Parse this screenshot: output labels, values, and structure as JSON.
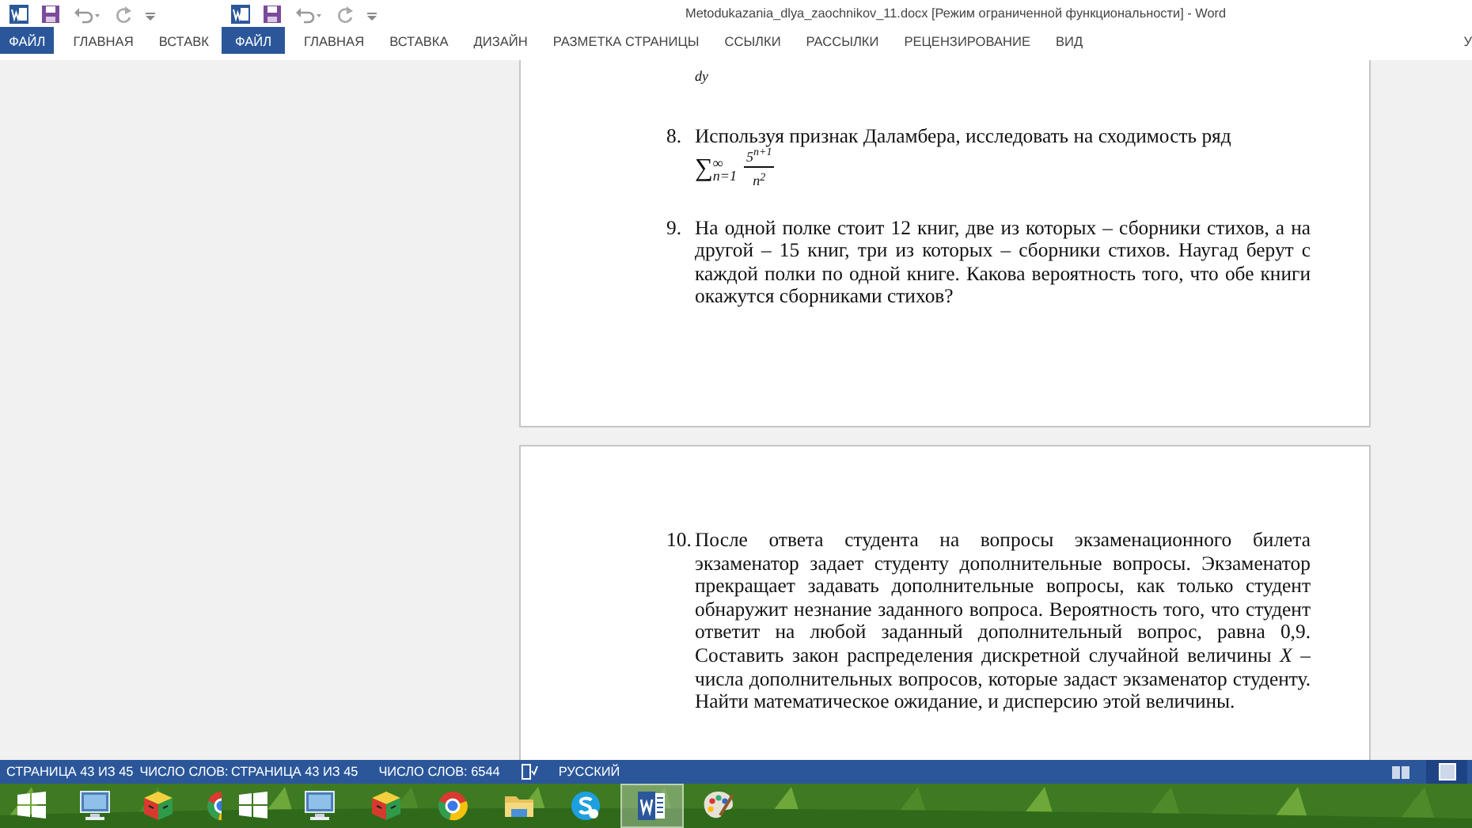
{
  "title_bar": {
    "title": "Metodukazania_dlya_zaochnikov_11.docx [Режим ограниченной функциональности] - Word"
  },
  "ribbon_tabs_back": [
    {
      "label": "ФАЙЛ",
      "kind": "file"
    },
    {
      "label": "ГЛАВНАЯ",
      "kind": "tab"
    },
    {
      "label": "ВСТАВК",
      "kind": "tab"
    }
  ],
  "ribbon_tabs": [
    {
      "label": "ФАЙЛ",
      "kind": "file"
    },
    {
      "label": "ГЛАВНАЯ",
      "kind": "tab"
    },
    {
      "label": "ВСТАВКА",
      "kind": "tab"
    },
    {
      "label": "ДИЗАЙН",
      "kind": "tab"
    },
    {
      "label": "РАЗМЕТКА СТРАНИЦЫ",
      "kind": "tab"
    },
    {
      "label": "ССЫЛКИ",
      "kind": "tab"
    },
    {
      "label": "РАССЫЛКИ",
      "kind": "tab"
    },
    {
      "label": "РЕЦЕНЗИРОВАНИЕ",
      "kind": "tab"
    },
    {
      "label": "ВИД",
      "kind": "tab"
    }
  ],
  "user": "У",
  "pages": [
    {
      "blocks": [
        {
          "kind": "fragment",
          "text": "dy"
        },
        {
          "kind": "item",
          "number": "8.",
          "text": "Используя признак Даламбера, исследовать на сходимость ряд",
          "formula": {
            "sum": "∑",
            "lower": "n=1",
            "upper": "∞",
            "numerator": "5$^{n+1}$",
            "denominator": "n$^{2}$"
          }
        },
        {
          "kind": "item",
          "number": "9.",
          "text": "На одной полке стоит 12 книг, две из которых – сборники стихов, а на другой – 15 книг, три из которых – сборники стихов. Наугад берут с каждой полки по одной книге. Какова вероятность того, что обе книги окажутся сборниками стихов?"
        }
      ]
    },
    {
      "blocks": [
        {
          "kind": "item",
          "number": "10.",
          "text": "После ответа студента на вопросы экзаменационного билета экзаменатор задает студенту дополнительные вопросы. Экзаменатор прекращает задавать дополнительные вопросы, как только студент обнаружит незнание заданного вопроса. Вероятность того, что студент ответит на любой заданный дополнительный вопрос, равна 0,9. Составить закон распределения дискретной случайной величины *X* – числа дополнительных вопросов, которые задаст экзаменатор студенту. Найти математическое ожидание, и дисперсию этой величины."
        }
      ]
    }
  ],
  "status_back": [
    {
      "kind": "text",
      "text": "СТРАНИЦА 43 ИЗ 45"
    },
    {
      "kind": "text",
      "text": "ЧИСЛО СЛОВ:"
    }
  ],
  "status": [
    {
      "kind": "text",
      "text": "СТРАНИЦА 43 ИЗ 45"
    },
    {
      "kind": "text",
      "text": "ЧИСЛО СЛОВ: 6544"
    },
    {
      "kind": "proofing"
    },
    {
      "kind": "text",
      "text": "РУССКИЙ"
    }
  ],
  "views": [
    {
      "kind": "read",
      "selected": false
    },
    {
      "kind": "print",
      "selected": true
    }
  ],
  "taskbar_back": [
    {
      "kind": "windows"
    },
    {
      "kind": "computer"
    },
    {
      "kind": "cube"
    },
    {
      "kind": "chrome"
    }
  ],
  "taskbar": [
    {
      "kind": "windows",
      "selected": false
    },
    {
      "kind": "computer",
      "selected": false
    },
    {
      "kind": "cube",
      "selected": false
    },
    {
      "kind": "chrome",
      "selected": false
    },
    {
      "kind": "explorer",
      "selected": false
    },
    {
      "kind": "skype",
      "selected": false
    },
    {
      "kind": "word",
      "selected": true
    },
    {
      "kind": "paint",
      "selected": false
    }
  ]
}
